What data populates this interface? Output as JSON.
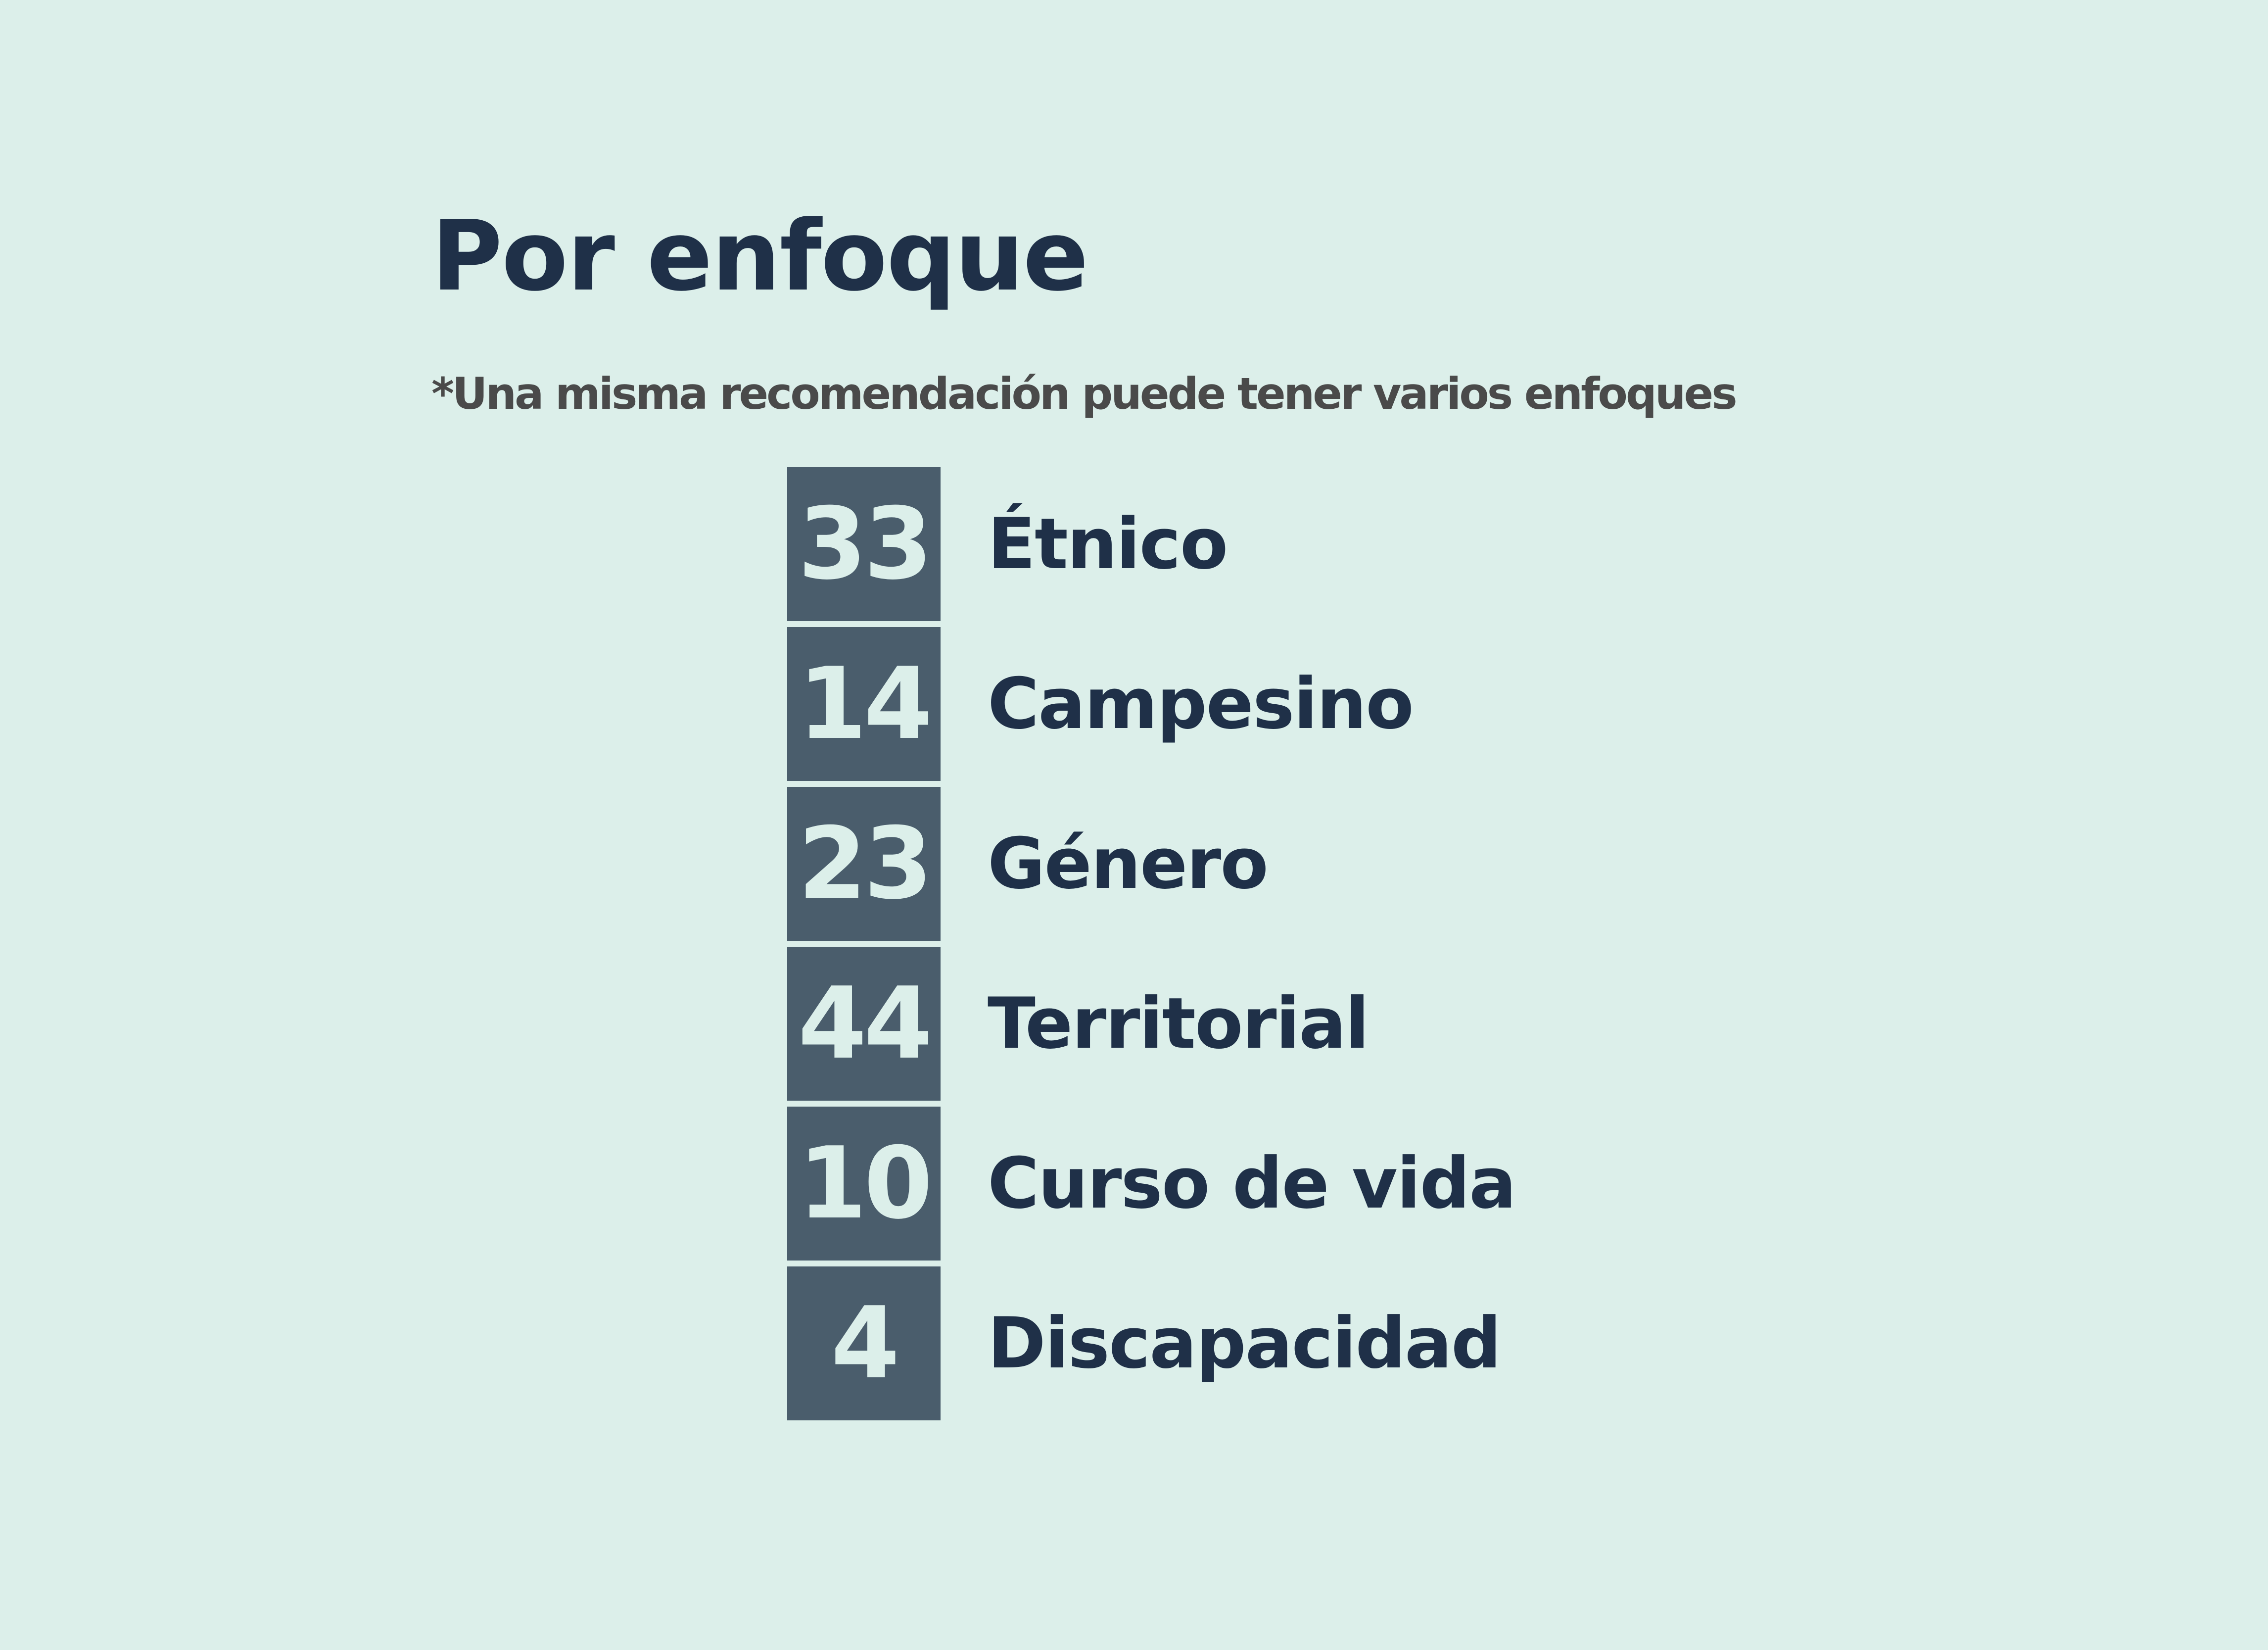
{
  "title": "Por enfoque",
  "subtitle": "*Una misma recomendación puede tener varios enfoques",
  "colors": {
    "background": "#dcefea",
    "box": "#4a5d6c",
    "number_text": "#dcefea",
    "label_text": "#1f3048",
    "subtitle_text": "#4a4a4a"
  },
  "items": [
    {
      "value": "33",
      "label": "Étnico"
    },
    {
      "value": "14",
      "label": "Campesino"
    },
    {
      "value": "23",
      "label": "Género"
    },
    {
      "value": "44",
      "label": "Territorial"
    },
    {
      "value": "10",
      "label": "Curso de vida"
    },
    {
      "value": "4",
      "label": "Discapacidad"
    }
  ]
}
